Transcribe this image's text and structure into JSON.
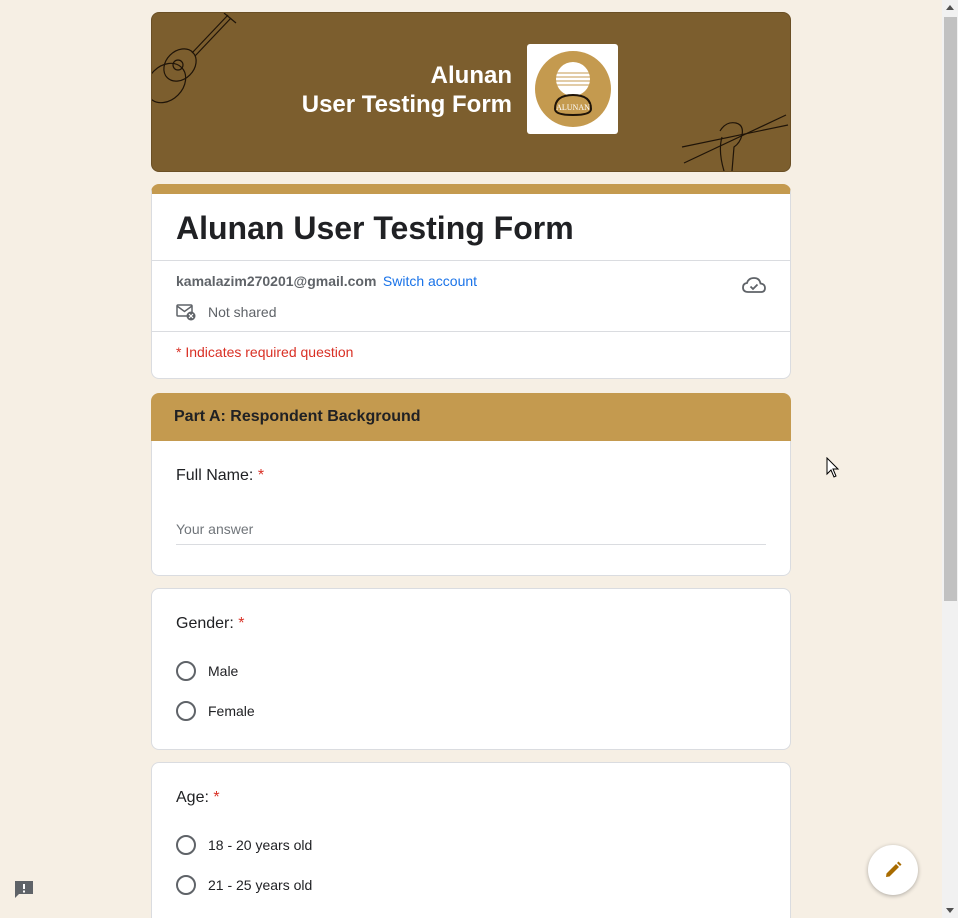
{
  "banner": {
    "title_line1": "Alunan",
    "title_line2": "User Testing Form",
    "logo_text": "ALUNAN"
  },
  "form": {
    "title": "Alunan User Testing Form",
    "account_email": "kamalazim270201@gmail.com",
    "switch_account_label": "Switch account",
    "shared_status": "Not shared",
    "required_note": "* Indicates required question"
  },
  "section": {
    "title": "Part A: Respondent Background"
  },
  "questions": {
    "full_name": {
      "label": "Full Name:",
      "required_mark": "*",
      "placeholder": "Your answer"
    },
    "gender": {
      "label": "Gender:",
      "required_mark": "*",
      "options": [
        "Male",
        "Female"
      ]
    },
    "age": {
      "label": "Age:",
      "required_mark": "*",
      "options": [
        "18 - 20 years old",
        "21 - 25 years old"
      ]
    }
  },
  "colors": {
    "accent": "#c49a4f",
    "banner": "#7c5e2e",
    "background": "#f6efe4",
    "required": "#d93025",
    "link": "#1a73e8"
  }
}
